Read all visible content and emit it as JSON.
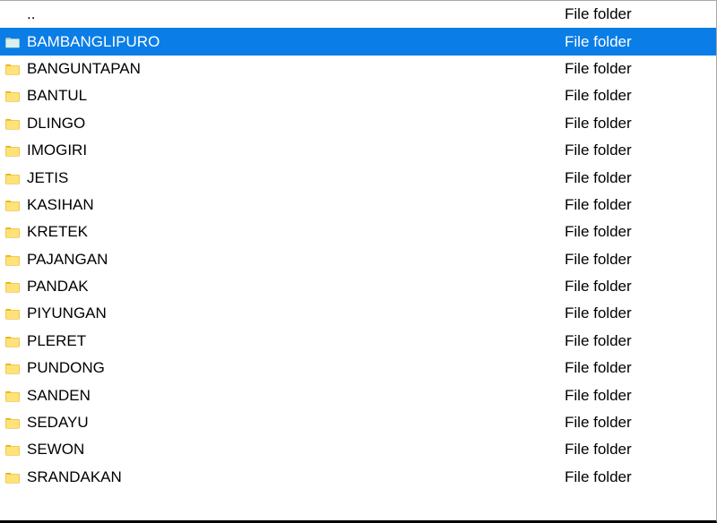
{
  "type_label": "File folder",
  "items": [
    {
      "name": "..",
      "selected": false
    },
    {
      "name": "BAMBANGLIPURO",
      "selected": true
    },
    {
      "name": "BANGUNTAPAN",
      "selected": false
    },
    {
      "name": "BANTUL",
      "selected": false
    },
    {
      "name": "DLINGO",
      "selected": false
    },
    {
      "name": "IMOGIRI",
      "selected": false
    },
    {
      "name": "JETIS",
      "selected": false
    },
    {
      "name": "KASIHAN",
      "selected": false
    },
    {
      "name": "KRETEK",
      "selected": false
    },
    {
      "name": "PAJANGAN",
      "selected": false
    },
    {
      "name": "PANDAK",
      "selected": false
    },
    {
      "name": "PIYUNGAN",
      "selected": false
    },
    {
      "name": "PLERET",
      "selected": false
    },
    {
      "name": "PUNDONG",
      "selected": false
    },
    {
      "name": "SANDEN",
      "selected": false
    },
    {
      "name": "SEDAYU",
      "selected": false
    },
    {
      "name": "SEWON",
      "selected": false
    },
    {
      "name": "SRANDAKAN",
      "selected": false
    }
  ]
}
